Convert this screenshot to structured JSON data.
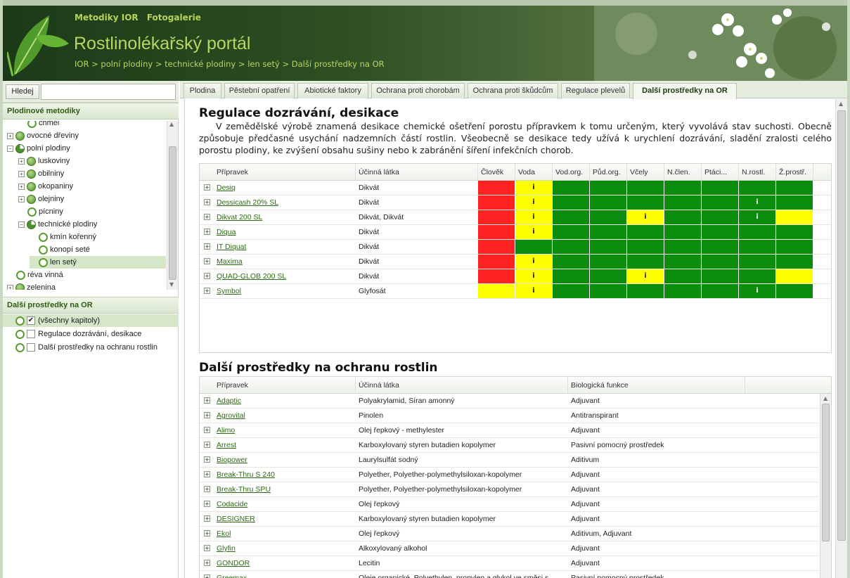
{
  "header": {
    "nav": [
      "Metodiky IOR",
      "Fotogalerie"
    ],
    "site_title": "Rostlinolékařský portál",
    "breadcrumb": [
      "IOR",
      "polní plodiny",
      "technické plodiny",
      "len setý",
      "Další prostředky na OR"
    ],
    "breadcrumb_sep": " > "
  },
  "search": {
    "button_label": "Hledej",
    "value": ""
  },
  "tree_panel": {
    "title": "Plodinové metodiky",
    "items": [
      {
        "label": "chmel",
        "icon": "ring",
        "expander": "",
        "depth": 1
      },
      {
        "label": "ovocné dřeviny",
        "icon": "ball",
        "expander": "+",
        "depth": 0
      },
      {
        "label": "polní plodiny",
        "icon": "pie",
        "expander": "−",
        "depth": 0
      },
      {
        "label": "luskoviny",
        "icon": "ball",
        "expander": "+",
        "depth": 1
      },
      {
        "label": "obilniny",
        "icon": "ball",
        "expander": "+",
        "depth": 1
      },
      {
        "label": "okopaniny",
        "icon": "ball",
        "expander": "+",
        "depth": 1
      },
      {
        "label": "olejniny",
        "icon": "ball",
        "expander": "+",
        "depth": 1
      },
      {
        "label": "pícniny",
        "icon": "ring",
        "expander": "",
        "depth": 1
      },
      {
        "label": "technické plodiny",
        "icon": "pie",
        "expander": "−",
        "depth": 1
      },
      {
        "label": "kmín kořenný",
        "icon": "ring",
        "expander": "",
        "depth": 2
      },
      {
        "label": "konopí seté",
        "icon": "ring",
        "expander": "",
        "depth": 2
      },
      {
        "label": "len setý",
        "icon": "ring",
        "expander": "",
        "depth": 2,
        "selected": true
      },
      {
        "label": "réva vinná",
        "icon": "ring",
        "expander": "",
        "depth": 0
      },
      {
        "label": "zelenina",
        "icon": "ball",
        "expander": "+",
        "depth": 0
      }
    ]
  },
  "chapter_panel": {
    "title": "Další prostředky na OR",
    "items": [
      {
        "label": "(všechny kapitoly)",
        "checked": true,
        "check_mark": "✔"
      },
      {
        "label": "Regulace dozrávání, desikace",
        "checked": false,
        "check_mark": ""
      },
      {
        "label": "Další prostředky na ochranu rostlin",
        "checked": false,
        "check_mark": ""
      }
    ]
  },
  "tabs": [
    {
      "label": "Plodina",
      "active": false
    },
    {
      "label": "Pěstební opatření",
      "active": false
    },
    {
      "label": "Abiotické faktory",
      "active": false
    },
    {
      "label": "Ochrana proti chorobám",
      "active": false
    },
    {
      "label": "Ochrana proti škůdcům",
      "active": false
    },
    {
      "label": "Regulace plevelů",
      "active": false
    },
    {
      "label": "Další prostředky na OR",
      "active": true
    }
  ],
  "section1": {
    "title": "Regulace dozrávání, desikace",
    "intro": "V zemědělské výrobě znamená desikace chemické ošetření porostu přípravkem k tomu určeným, který vyvolává stav suchosti. Obecně způsobuje předčasné usychání nadzemních částí rostlin. Všeobecně se desikace tedy užívá k urychlení dozrávání, sladění zralosti celého porostu plodiny, ke zvýšení obsahu sušiny nebo k zabránění šíření infekčních chorob.",
    "columns": [
      "Přípravek",
      "Účinná látka",
      "Člověk",
      "Voda",
      "Vod.org.",
      "Půd.org.",
      "Včely",
      "N.člen.",
      "Ptáci...",
      "N.rostl.",
      "Ž.prostř."
    ],
    "colors": {
      "R": "#ff2222",
      "Y": "#ffff00",
      "G": "#0c8c0c"
    },
    "info_mark": "i",
    "rows": [
      {
        "name": "Desiq",
        "substance": "Dikvát",
        "risk": [
          "R",
          "Yi",
          "G",
          "G",
          "G",
          "G",
          "G",
          "G",
          "G"
        ]
      },
      {
        "name": "Dessicash 20% SL",
        "substance": "Dikvát",
        "risk": [
          "R",
          "Yi",
          "G",
          "G",
          "G",
          "G",
          "G",
          "Gi",
          "G"
        ]
      },
      {
        "name": "Dikvat 200 SL",
        "substance": "Dikvát, Dikvát",
        "risk": [
          "R",
          "Yi",
          "G",
          "G",
          "Yi",
          "G",
          "G",
          "Gi",
          "Y"
        ]
      },
      {
        "name": "Diqua",
        "substance": "Dikvát",
        "risk": [
          "R",
          "Yi",
          "G",
          "G",
          "G",
          "G",
          "G",
          "G",
          "G"
        ]
      },
      {
        "name": "IT Diquat",
        "substance": "Dikvát",
        "risk": [
          "R",
          "G",
          "G",
          "G",
          "G",
          "G",
          "G",
          "G",
          "G"
        ]
      },
      {
        "name": "Maxima",
        "substance": "Dikvát",
        "risk": [
          "R",
          "Yi",
          "G",
          "G",
          "G",
          "G",
          "G",
          "G",
          "G"
        ]
      },
      {
        "name": "QUAD-GLOB 200 SL",
        "substance": "Dikvát",
        "risk": [
          "R",
          "Yi",
          "G",
          "G",
          "Yi",
          "G",
          "G",
          "G",
          "Y"
        ]
      },
      {
        "name": "Symbol",
        "substance": "Glyfosát",
        "risk": [
          "Y",
          "Yi",
          "G",
          "G",
          "G",
          "G",
          "G",
          "Gi",
          "G"
        ]
      }
    ]
  },
  "section2": {
    "title": "Další prostředky na ochranu rostlin",
    "columns": [
      "Přípravek",
      "Účinná látka",
      "Biologická funkce"
    ],
    "rows": [
      {
        "name": "Adaptic",
        "substance": "Polyakrylamid, Síran amonný",
        "function": "Adjuvant"
      },
      {
        "name": "Agrovital",
        "substance": "Pinolen",
        "function": "Antitranspirant"
      },
      {
        "name": "Alimo",
        "substance": "Olej řepkový - methylester",
        "function": "Adjuvant"
      },
      {
        "name": "Arrest",
        "substance": "Karboxylovaný styren butadien kopolymer",
        "function": "Pasivní pomocný prostředek"
      },
      {
        "name": "Biopower",
        "substance": "Laurylsulfát sodný",
        "function": "Aditivum"
      },
      {
        "name": "Break-Thru S 240",
        "substance": "Polyether, Polyether-polymethylsiloxan-kopolymer",
        "function": "Adjuvant"
      },
      {
        "name": "Break-Thru SPU",
        "substance": "Polyether, Polyether-polymethylsiloxan-kopolymer",
        "function": "Adjuvant"
      },
      {
        "name": "Codacide",
        "substance": "Olej řepkový",
        "function": "Adjuvant"
      },
      {
        "name": "DESIGNER",
        "substance": "Karboxylovaný styren butadien kopolymer",
        "function": "Adjuvant"
      },
      {
        "name": "Ekol",
        "substance": "Olej řepkový",
        "function": "Aditivum, Adjuvant"
      },
      {
        "name": "Glyfin",
        "substance": "Alkoxylovaný alkohol",
        "function": "Adjuvant"
      },
      {
        "name": "GONDOR",
        "substance": "Lecitin",
        "function": "Adjuvant"
      },
      {
        "name": "Greemax",
        "substance": "Oleje organické, Polyethylen, propylen a glykol ve směsi s",
        "function": "Pasivní pomocný prostředek"
      }
    ]
  }
}
